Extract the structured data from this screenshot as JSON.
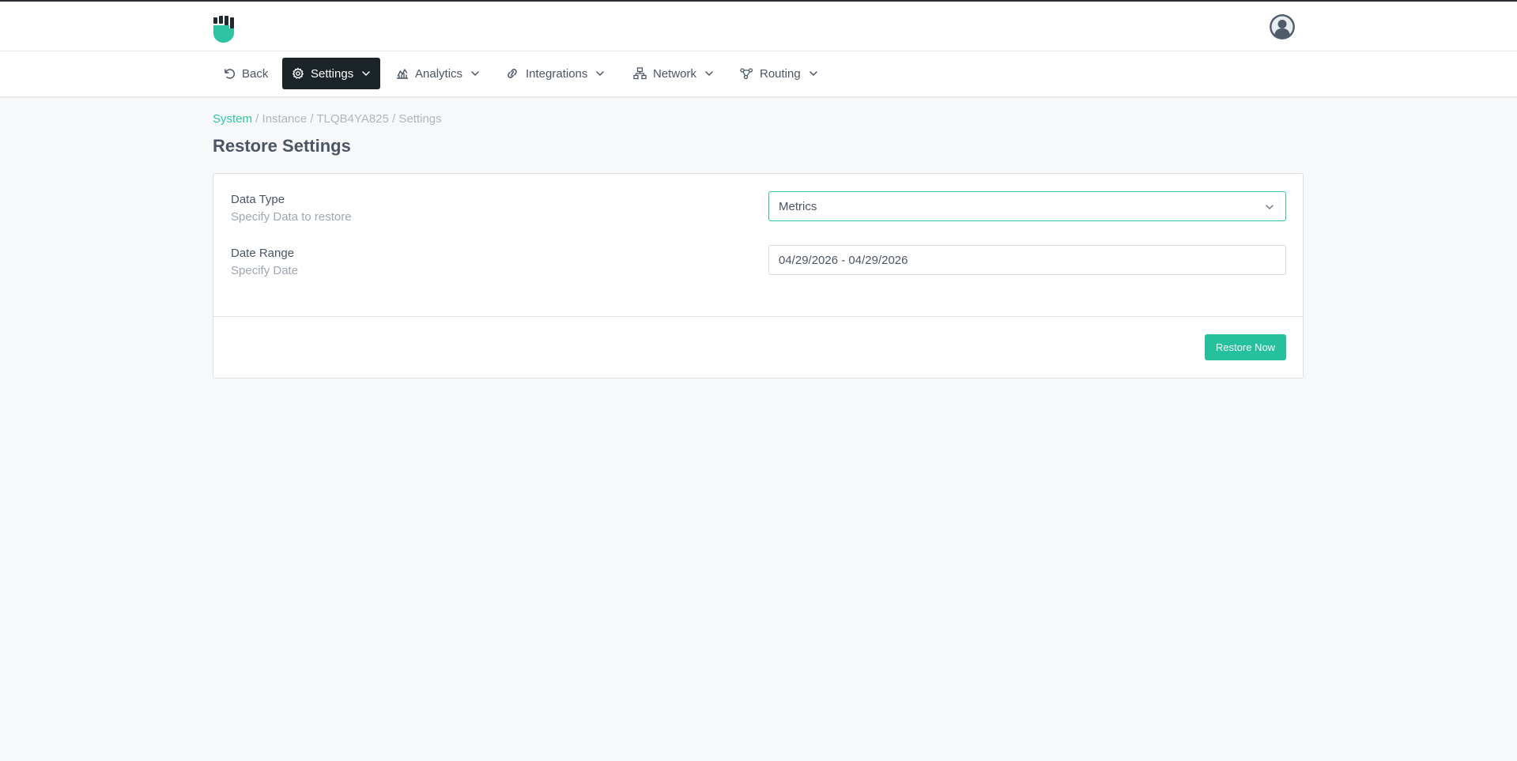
{
  "header": {
    "logo_icon": "fist-shield-logo",
    "avatar_icon": "user-avatar-icon",
    "brand_color": "#2ec4a3"
  },
  "nav": {
    "items": [
      {
        "label": "Back",
        "icon": "undo-icon",
        "has_dropdown": false,
        "active": false
      },
      {
        "label": "Settings",
        "icon": "gear-icon",
        "has_dropdown": true,
        "active": true
      },
      {
        "label": "Analytics",
        "icon": "line-chart-icon",
        "has_dropdown": true,
        "active": false
      },
      {
        "label": "Integrations",
        "icon": "link-icon",
        "has_dropdown": true,
        "active": false
      },
      {
        "label": "Network",
        "icon": "network-icon",
        "has_dropdown": true,
        "active": false
      },
      {
        "label": "Routing",
        "icon": "routing-icon",
        "has_dropdown": true,
        "active": false
      }
    ]
  },
  "breadcrumb": {
    "items": [
      "System",
      "Instance",
      "TLQB4YA825",
      "Settings"
    ],
    "separator": " / "
  },
  "page": {
    "title": "Restore Settings"
  },
  "form": {
    "data_type": {
      "label": "Data Type",
      "help": "Specify Data to restore",
      "value": "Metrics"
    },
    "date_range": {
      "label": "Date Range",
      "help": "Specify Date",
      "value": "04/29/2026 - 04/29/2026"
    },
    "submit_label": "Restore Now"
  },
  "colors": {
    "accent": "#25c09c",
    "active_nav_bg": "#1b2428",
    "page_bg": "#f7f8fa"
  }
}
